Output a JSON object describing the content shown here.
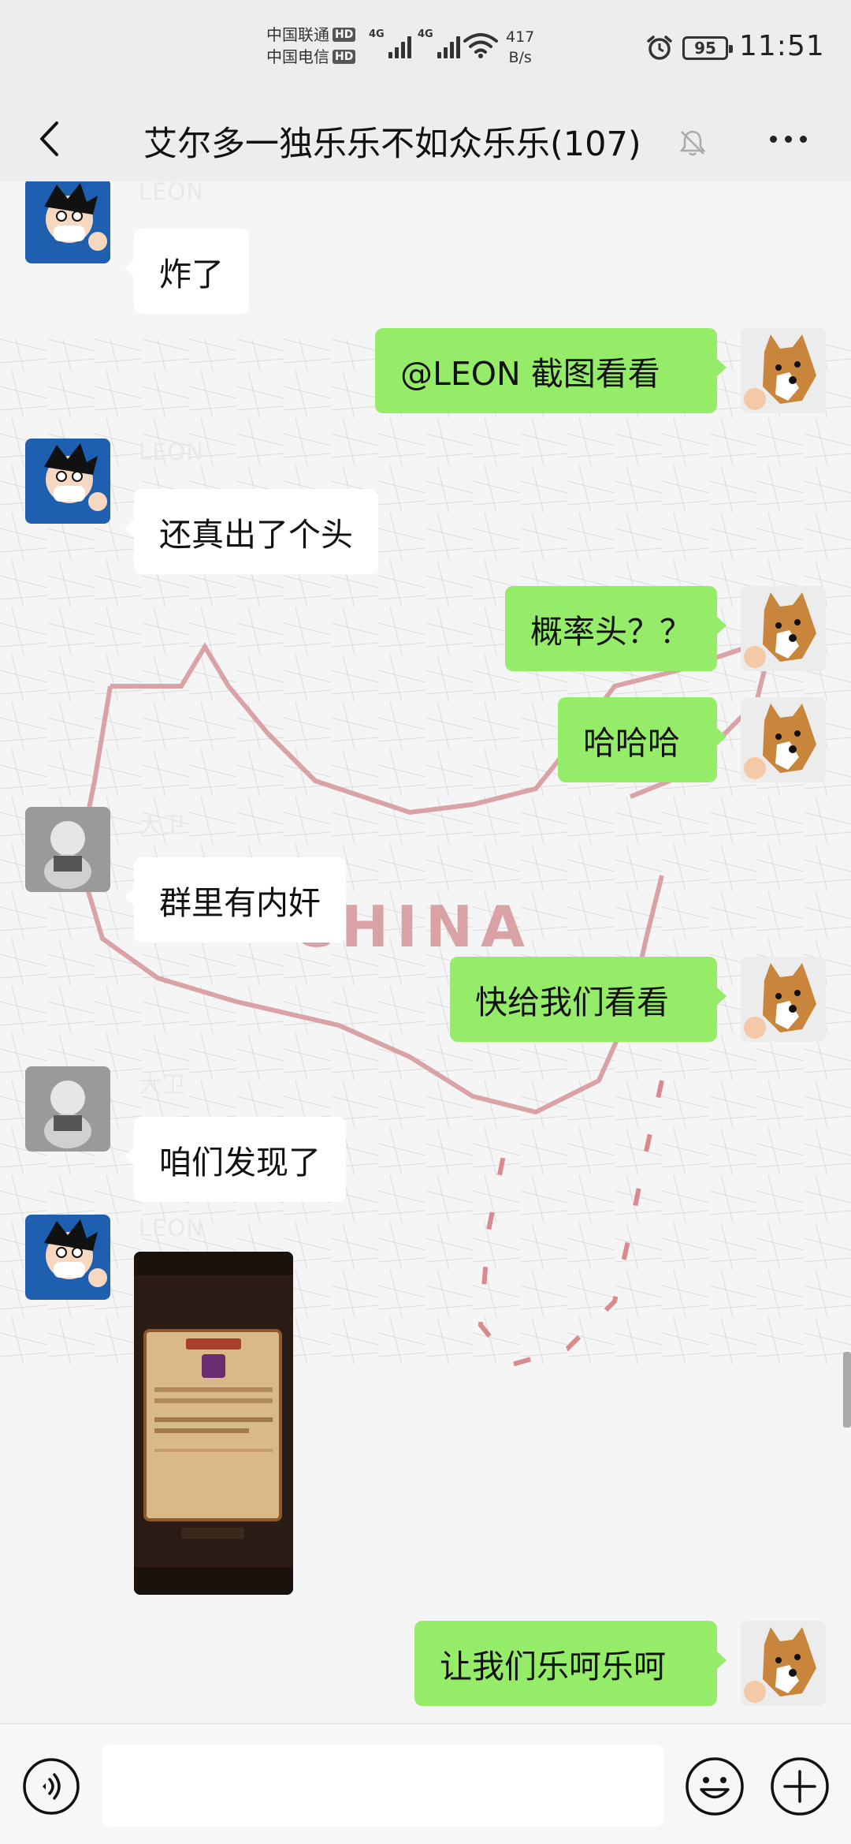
{
  "status_bar": {
    "carrier1": "中国联通",
    "carrier2": "中国电信",
    "hd": "HD",
    "network": "4G",
    "speed_value": "417",
    "speed_unit": "B/s",
    "battery": "95",
    "time": "11:51"
  },
  "header": {
    "title": "艾尔多一独乐乐不如众乐乐(107)",
    "back_icon": "chevron-left-icon",
    "mute_icon": "bell-off-icon",
    "more_icon": "more-horizontal-icon"
  },
  "background": {
    "map_label": "CHINA"
  },
  "messages": [
    {
      "sender": "LEON",
      "text": "炸了",
      "direction": "in"
    },
    {
      "sender": "",
      "text": "@LEON  截图看看",
      "direction": "out"
    },
    {
      "sender": "LEON",
      "text": "还真出了个头",
      "direction": "in"
    },
    {
      "sender": "",
      "text": "概率头？？",
      "direction": "out"
    },
    {
      "sender": "",
      "text": "哈哈哈",
      "direction": "out"
    },
    {
      "sender": "大卫",
      "text": "群里有内奸",
      "direction": "in"
    },
    {
      "sender": "",
      "text": "快给我们看看",
      "direction": "out"
    },
    {
      "sender": "大卫",
      "text": "咱们发现了",
      "direction": "in"
    },
    {
      "sender": "LEON",
      "text": "",
      "direction": "in",
      "type": "image"
    },
    {
      "sender": "",
      "text": "让我们乐呵乐呵",
      "direction": "out"
    }
  ],
  "input_bar": {
    "voice_icon": "voice-icon",
    "placeholder": "",
    "emoji_icon": "emoji-icon",
    "plus_icon": "plus-icon"
  },
  "colors": {
    "out_bubble": "#95ec69",
    "in_bubble": "#ffffff",
    "bar_bg": "#ededed"
  }
}
